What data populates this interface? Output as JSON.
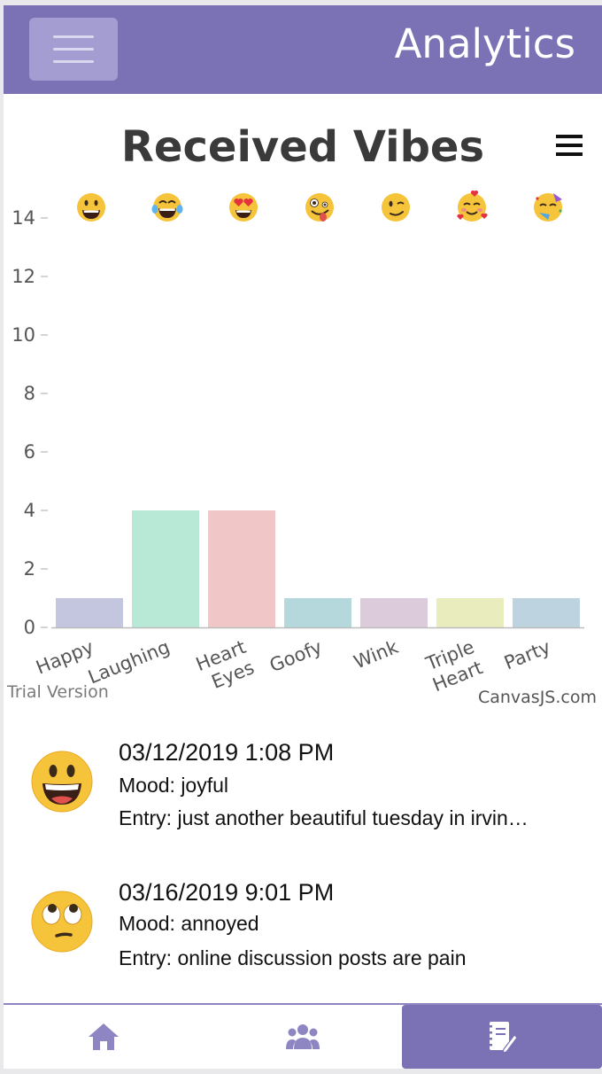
{
  "header": {
    "title": "Analytics",
    "menu_icon": "hamburger-icon"
  },
  "chart_data": {
    "type": "bar",
    "title": "Received Vibes",
    "categories": [
      "Happy",
      "Laughing",
      "Heart Eyes",
      "Goofy",
      "Wink",
      "Triple Heart",
      "Party"
    ],
    "values": [
      1,
      4,
      4,
      1,
      1,
      1,
      1
    ],
    "colors": [
      "#c4c5df",
      "#b8e9d6",
      "#f0c7c6",
      "#b4d8db",
      "#dccbda",
      "#e9edbe",
      "#bdd3df"
    ],
    "emoji_icons": [
      "grinning-face-icon",
      "tears-of-joy-icon",
      "heart-eyes-icon",
      "zany-face-icon",
      "winking-face-icon",
      "smiling-hearts-icon",
      "partying-face-icon"
    ],
    "y_ticks": [
      "0",
      "2",
      "4",
      "6",
      "8",
      "10",
      "12",
      "14"
    ],
    "ylim": [
      0,
      14
    ],
    "grid": false,
    "watermark": "Trial Version",
    "credit": "CanvasJS.com"
  },
  "entries": [
    {
      "date": "03/12/2019 1:08 PM",
      "mood": "Mood: joyful",
      "entry": "Entry: just another beautiful tuesday in irvin…",
      "icon": "grinning-face-icon"
    },
    {
      "date": "03/16/2019 9:01 PM",
      "mood": "Mood: annoyed",
      "entry": "Entry: online discussion posts are pain",
      "icon": "rolling-eyes-icon"
    }
  ],
  "nav": {
    "items": [
      {
        "icon": "home-icon",
        "active": false
      },
      {
        "icon": "friends-icon",
        "active": false
      },
      {
        "icon": "journal-icon",
        "active": true
      }
    ],
    "accent": "#7b72b6"
  }
}
